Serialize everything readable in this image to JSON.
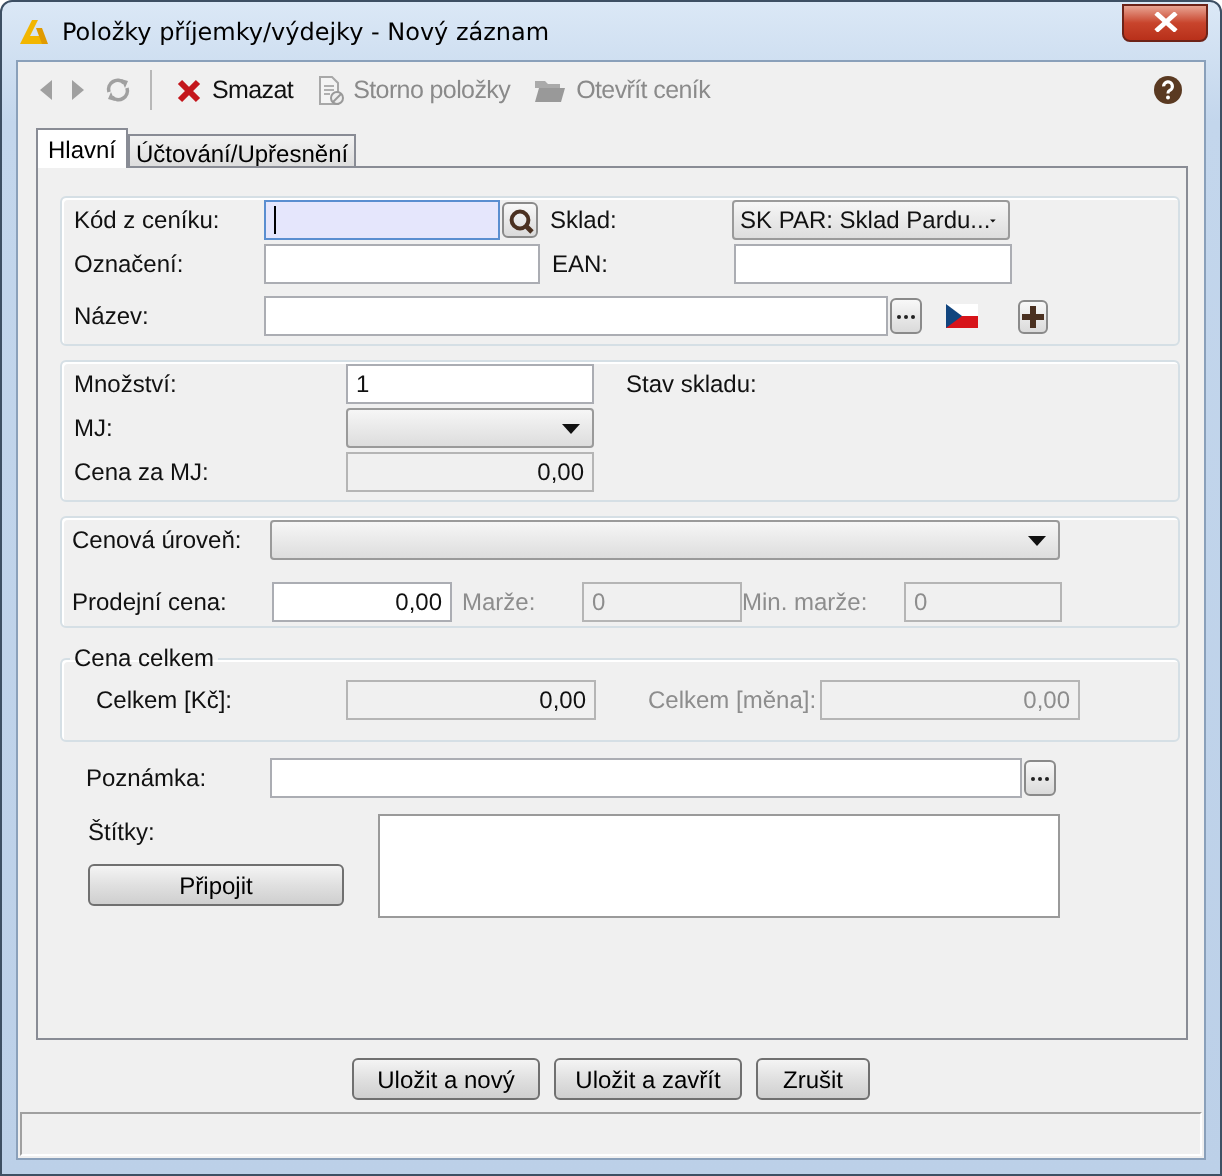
{
  "window": {
    "title": "Položky příjemky/výdejky - Nový záznam"
  },
  "toolbar": [
    {
      "kind": "back",
      "disabled": true
    },
    {
      "kind": "forward",
      "disabled": true
    },
    {
      "kind": "refresh",
      "disabled": true
    },
    {
      "kind": "delete",
      "label": "Smazat",
      "disabled": false
    },
    {
      "kind": "cancel",
      "label": "Storno položky",
      "disabled": true
    },
    {
      "kind": "open",
      "label": "Otevřít ceník",
      "disabled": true
    },
    {
      "kind": "help",
      "disabled": false
    }
  ],
  "tabs": [
    {
      "label": "Hlavní",
      "selected": true
    },
    {
      "label": "Účtování/Upřesnění",
      "selected": false
    }
  ],
  "item": {
    "code": {
      "label": "Kód z ceníku:",
      "focused": true
    },
    "warehouse": {
      "label": "Sklad:",
      "value": "SK PAR: Sklad Pardu..."
    },
    "designation": {
      "label": "Označení:"
    },
    "ean": {
      "label": "EAN:"
    },
    "name": {
      "label": "Název:"
    },
    "quantity": {
      "label": "Množství:",
      "value": "1"
    },
    "stock": {
      "label": "Stav skladu:"
    },
    "unit": {
      "label": "MJ:"
    },
    "unit_price": {
      "label": "Cena za MJ:",
      "value": "0,00",
      "readonly": true
    },
    "price_level": {
      "label": "Cenová úroveň:"
    },
    "sale_price": {
      "label": "Prodejní cena:",
      "value": "0,00"
    },
    "margin": {
      "label": "Marže:",
      "value": "0",
      "disabled": true
    },
    "min_margin": {
      "label": "Min. marže:",
      "value": "0",
      "disabled": true
    }
  },
  "total": {
    "title": "Cena celkem",
    "czk": {
      "label": "Celkem [Kč]:",
      "value": "0,00",
      "readonly": true
    },
    "currency": {
      "label": "Celkem [měna]:",
      "value": "0,00",
      "disabled": true
    }
  },
  "note": {
    "label": "Poznámka:"
  },
  "tags": {
    "label": "Štítky:",
    "button": "Připojit"
  },
  "buttons": [
    "Uložit a nový",
    "Uložit a zavřít",
    "Zrušit"
  ]
}
